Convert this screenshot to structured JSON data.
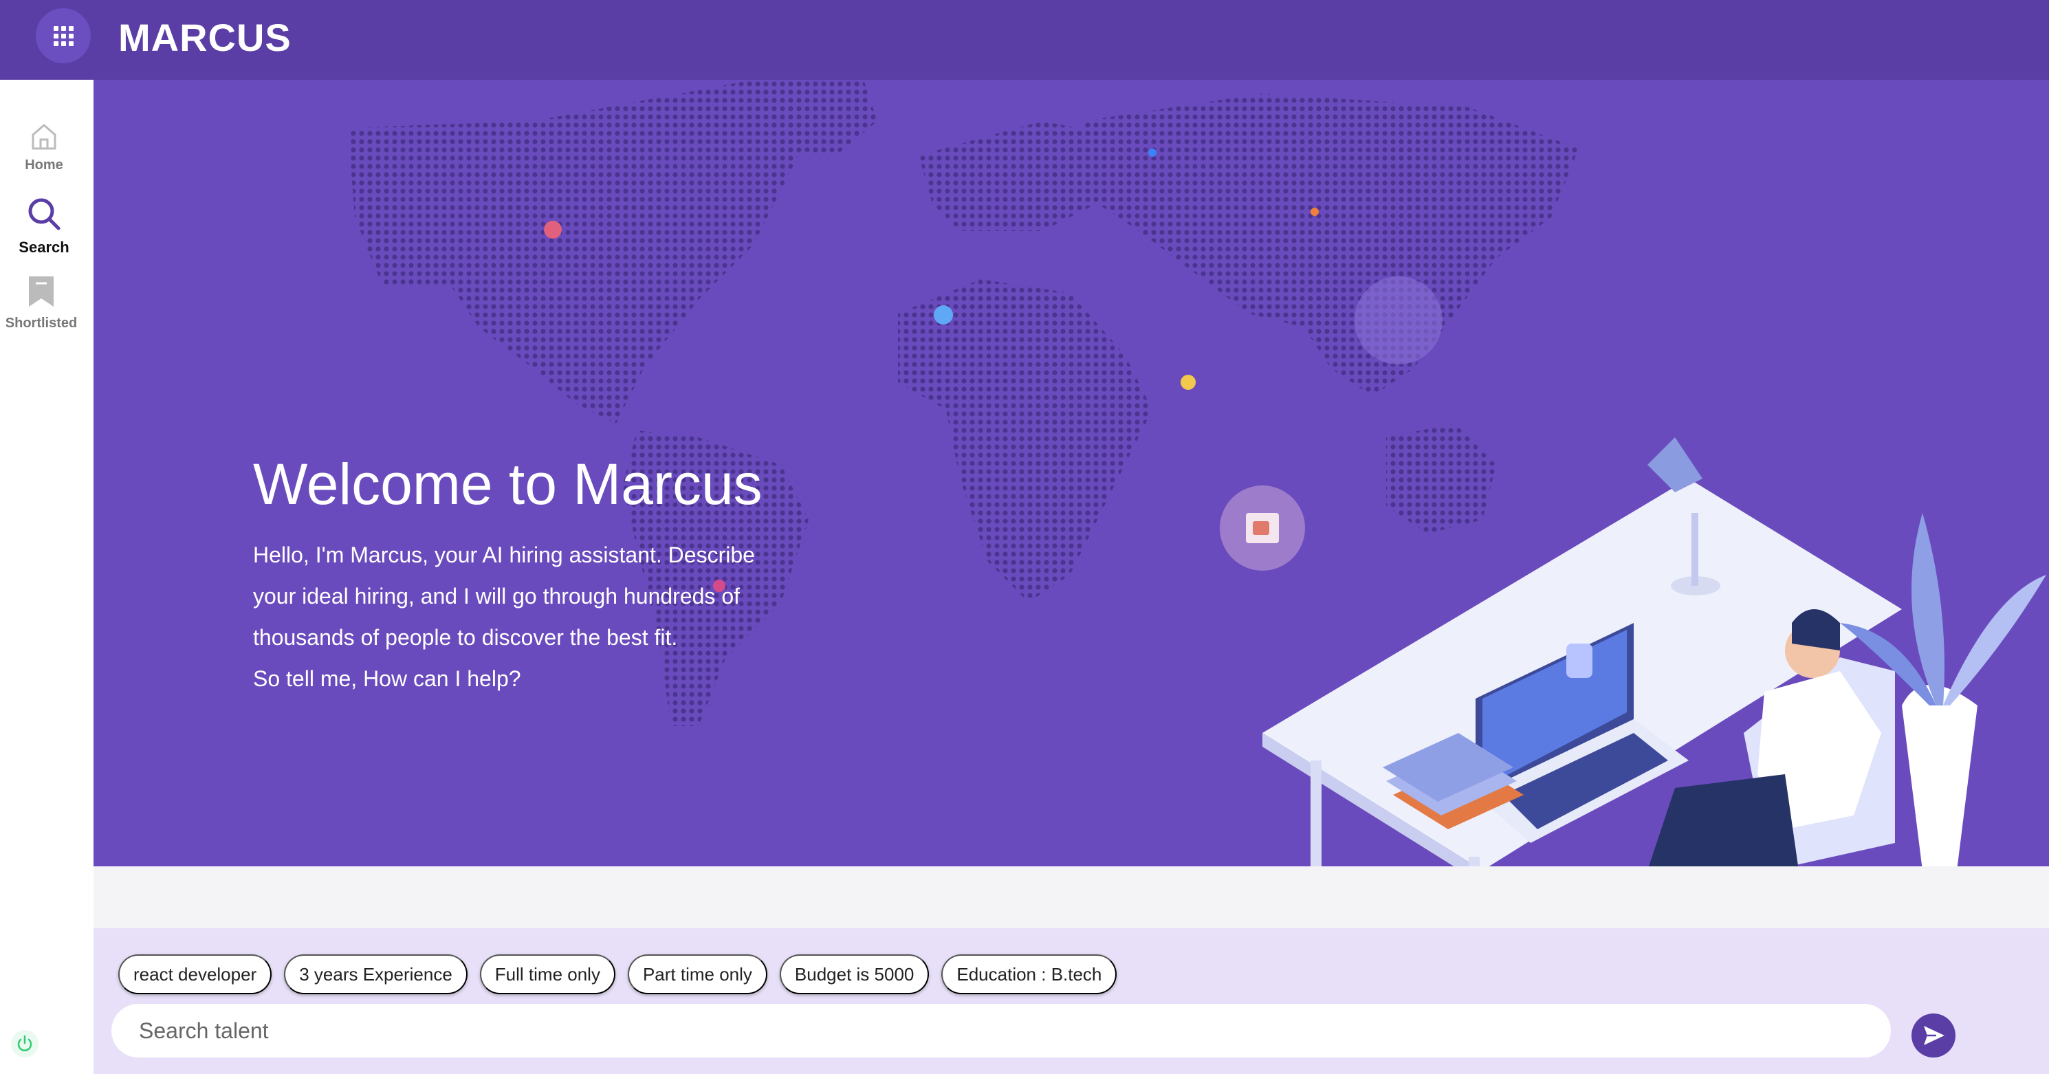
{
  "app": {
    "brand": "MARCUS"
  },
  "sidebar": {
    "items": [
      {
        "label": "Home",
        "icon": "home-icon",
        "active": false
      },
      {
        "label": "Search",
        "icon": "search-icon",
        "active": true
      },
      {
        "label": "Shortlisted",
        "icon": "bookmark-icon",
        "active": false
      }
    ]
  },
  "hero": {
    "title": "Welcome to Marcus",
    "lines": [
      "Hello, I'm Marcus, your AI hiring assistant. Describe",
      "your ideal hiring, and I will go through hundreds of",
      "thousands of people to discover the best fit.",
      "So tell me, How can I help?"
    ]
  },
  "suggestions": [
    "react developer",
    "3 years Experience",
    "Full time only",
    "Part time only",
    "Budget is 5000",
    "Education : B.tech"
  ],
  "search": {
    "placeholder": "Search talent",
    "value": ""
  },
  "colors": {
    "header": "#5a3ea6",
    "hero": "#6a4bbd",
    "panel": "#e7e0f8",
    "accent": "#5a3ea6"
  }
}
